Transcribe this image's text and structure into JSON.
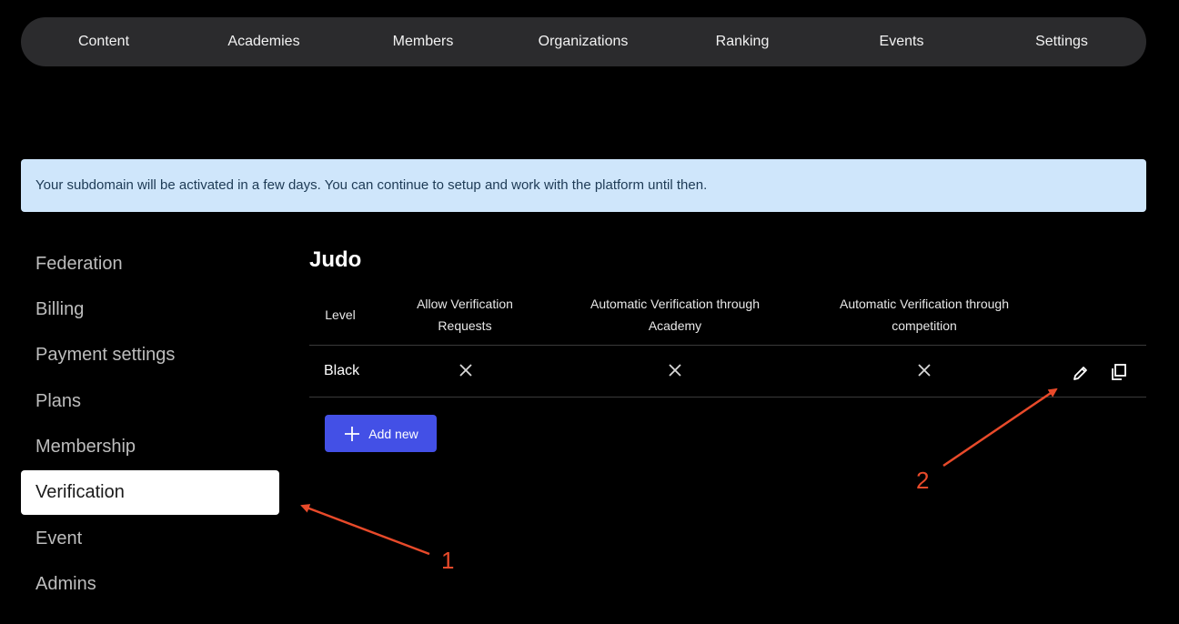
{
  "nav": {
    "items": [
      "Content",
      "Academies",
      "Members",
      "Organizations",
      "Ranking",
      "Events",
      "Settings"
    ]
  },
  "banner": {
    "text": "Your subdomain will be activated in a few days. You can continue to setup and work with the platform until then."
  },
  "sidebar": {
    "items": [
      "Federation",
      "Billing",
      "Payment settings",
      "Plans",
      "Membership",
      "Verification",
      "Event",
      "Admins"
    ],
    "active": "Verification"
  },
  "main": {
    "title": "Judo",
    "table": {
      "headers": {
        "level": "Level",
        "allow_line1": "Allow Verification",
        "allow_line2": "Requests",
        "academy_line1": "Automatic Verification through",
        "academy_line2": "Academy",
        "competition_line1": "Automatic Verification through",
        "competition_line2": "competition"
      },
      "rows": [
        {
          "level": "Black",
          "allow": false,
          "academy": false,
          "competition": false
        }
      ]
    },
    "add_button_label": "Add new"
  },
  "annotations": {
    "label1": "1",
    "label2": "2",
    "color": "#e84a2a"
  },
  "colors": {
    "accent": "#4350e6",
    "banner_bg": "#cfe6fb",
    "nav_bg": "#2b2b2d"
  }
}
